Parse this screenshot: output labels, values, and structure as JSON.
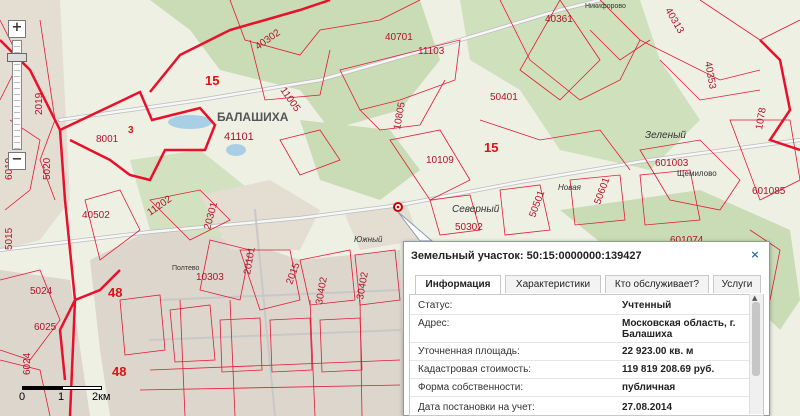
{
  "map": {
    "city_name": "БАЛАШИХА",
    "settlements": [
      "Северный",
      "Южный",
      "Новая",
      "Зеленый",
      "Щемилово",
      "Никифорово",
      "Полтево"
    ],
    "parcel_numbers": [
      "40302",
      "40701",
      "11103",
      "40361",
      "40353",
      "40313",
      "41101",
      "11005",
      "10805",
      "50401",
      "601085",
      "601003",
      "601074",
      "40502",
      "11202",
      "20301",
      "20101",
      "30402",
      "50302",
      "50501",
      "50601",
      "5024",
      "6025",
      "6024",
      "8001",
      "2019",
      "5020",
      "1078",
      "10109",
      "10303",
      "30402",
      "2015",
      "6019",
      "5015"
    ],
    "route_labels": [
      "15",
      "15",
      "48",
      "48",
      "3"
    ],
    "colors": {
      "boundary": "#e8102a",
      "parcel": "#e31a36",
      "forest": "#c9dcb5",
      "field": "#eef0e4",
      "road": "#f4f4f4",
      "urban": "#ddd6cc"
    }
  },
  "zoom": {
    "plus": "+",
    "minus": "−",
    "level_fraction": 0.12
  },
  "scale": {
    "labels": [
      "0",
      "1",
      "2км"
    ]
  },
  "marker": {
    "icon": "location-pin-icon"
  },
  "popup": {
    "title": "Земельный участок: 50:15:0000000:139427",
    "close": "×",
    "tabs": [
      "Информация",
      "Характеристики",
      "Кто обслуживает?",
      "Услуги"
    ],
    "active_tab": 0,
    "fields": [
      {
        "label": "Статус:",
        "value": "Учтенный"
      },
      {
        "label": "Адрес:",
        "value": "Московская область, г. Балашиха"
      },
      {
        "label": "Уточненная площадь:",
        "value": "22 923.00 кв. м"
      },
      {
        "label": "Кадастровая стоимость:",
        "value": "119 819 208.69 руб."
      },
      {
        "label": "Форма собственности:",
        "value": "публичная"
      },
      {
        "label": "Дата постановки на учет:",
        "value": "27.08.2014"
      }
    ]
  }
}
